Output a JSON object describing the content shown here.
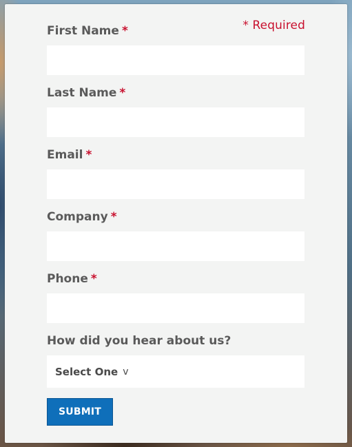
{
  "form": {
    "required_note": "* Required",
    "fields": [
      {
        "label": "First Name",
        "required_mark": "*",
        "value": "",
        "placeholder": ""
      },
      {
        "label": "Last Name",
        "required_mark": "*",
        "value": "",
        "placeholder": ""
      },
      {
        "label": "Email",
        "required_mark": "*",
        "value": "",
        "placeholder": ""
      },
      {
        "label": "Company",
        "required_mark": "*",
        "value": "",
        "placeholder": ""
      },
      {
        "label": "Phone",
        "required_mark": "*",
        "value": "",
        "placeholder": ""
      }
    ],
    "source_question": {
      "label": "How did you hear about us?",
      "selected_value": "Select One",
      "chevron": "v"
    },
    "submit_label": "SUBMIT"
  },
  "colors": {
    "required": "#c8102e",
    "label": "#5a5a5a",
    "submit_bg": "#0f6fba",
    "card_bg": "#f3f4f3",
    "input_bg": "#ffffff"
  }
}
